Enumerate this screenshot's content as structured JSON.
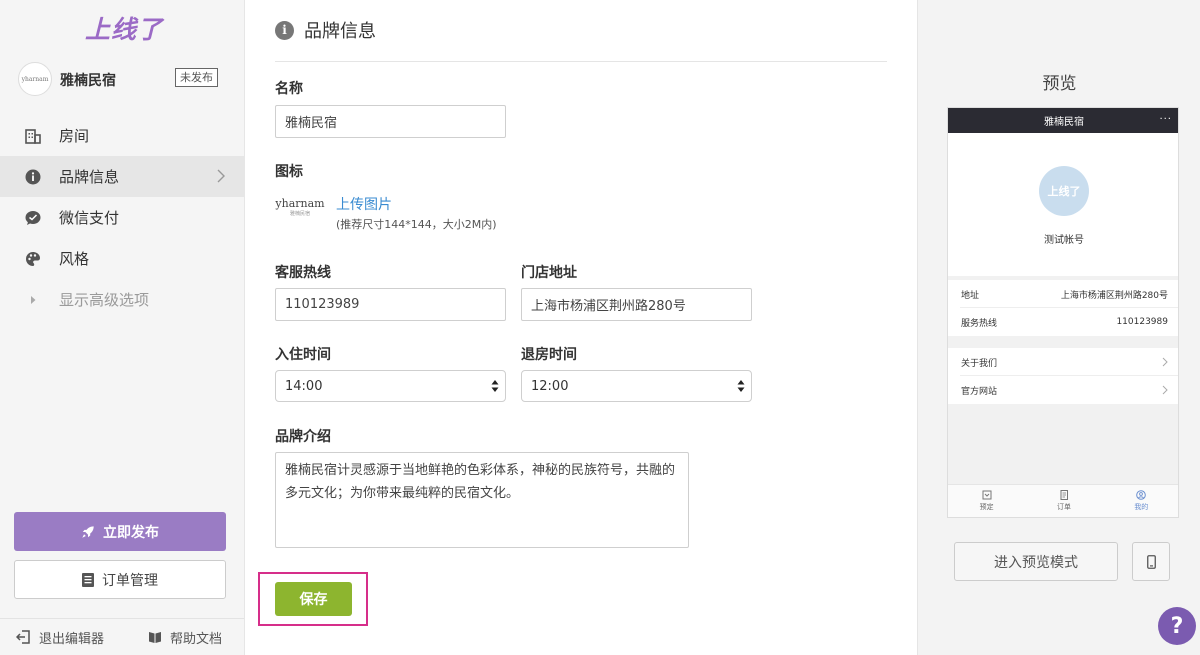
{
  "sidebar": {
    "logo": "上线了",
    "store": {
      "avatar_text": "yharnam",
      "name": "雅楠民宿",
      "status": "未发布"
    },
    "items": [
      {
        "label": "房间",
        "icon": "building-icon"
      },
      {
        "label": "品牌信息",
        "icon": "info-icon",
        "active": true
      },
      {
        "label": "微信支付",
        "icon": "wechat-icon"
      },
      {
        "label": "风格",
        "icon": "palette-icon"
      },
      {
        "label": "显示高级选项",
        "icon": "caret-right-icon"
      }
    ],
    "publish_label": "立即发布",
    "orders_label": "订单管理",
    "exit_label": "退出编辑器",
    "help_label": "帮助文档"
  },
  "main": {
    "section_title": "品牌信息",
    "name_label": "名称",
    "name_value": "雅楠民宿",
    "icon_label": "图标",
    "icon_preview_text": "yharnam",
    "icon_preview_subtext": "雅楠民宿",
    "upload_link": "上传图片",
    "upload_hint": "(推荐尺寸144*144，大小2M内)",
    "hotline_label": "客服热线",
    "hotline_value": "110123989",
    "address_label": "门店地址",
    "address_value": "上海市杨浦区荆州路280号",
    "checkin_label": "入住时间",
    "checkin_value": "14:00",
    "checkout_label": "退房时间",
    "checkout_value": "12:00",
    "intro_label": "品牌介绍",
    "intro_value": "雅楠民宿计灵感源于当地鲜艳的色彩体系，神秘的民族符号，共融的多元文化；为你带来最纯粹的民宿文化。",
    "save_label": "保存"
  },
  "preview": {
    "title": "预览",
    "phone": {
      "bar_title": "雅楠民宿",
      "bar_menu": "···",
      "avatar_text": "上线了",
      "account_name": "测试帐号",
      "rows": [
        {
          "label": "地址",
          "value": "上海市杨浦区荆州路280号"
        },
        {
          "label": "服务热线",
          "value": "110123989"
        }
      ],
      "links": [
        {
          "label": "关于我们"
        },
        {
          "label": "官方网站"
        }
      ],
      "tabs": [
        {
          "label": "预定",
          "icon": "bookmark-icon"
        },
        {
          "label": "订单",
          "icon": "receipt-icon"
        },
        {
          "label": "我的",
          "icon": "user-icon",
          "active": true
        }
      ]
    },
    "preview_mode_label": "进入预览模式",
    "help_fab": "?"
  },
  "colors": {
    "brand_purple": "#9b6ac6",
    "publish_button": "#9a7cc4",
    "save_button": "#8db52f",
    "highlight_border": "#d62e8a",
    "link_blue": "#3a8bd1"
  }
}
